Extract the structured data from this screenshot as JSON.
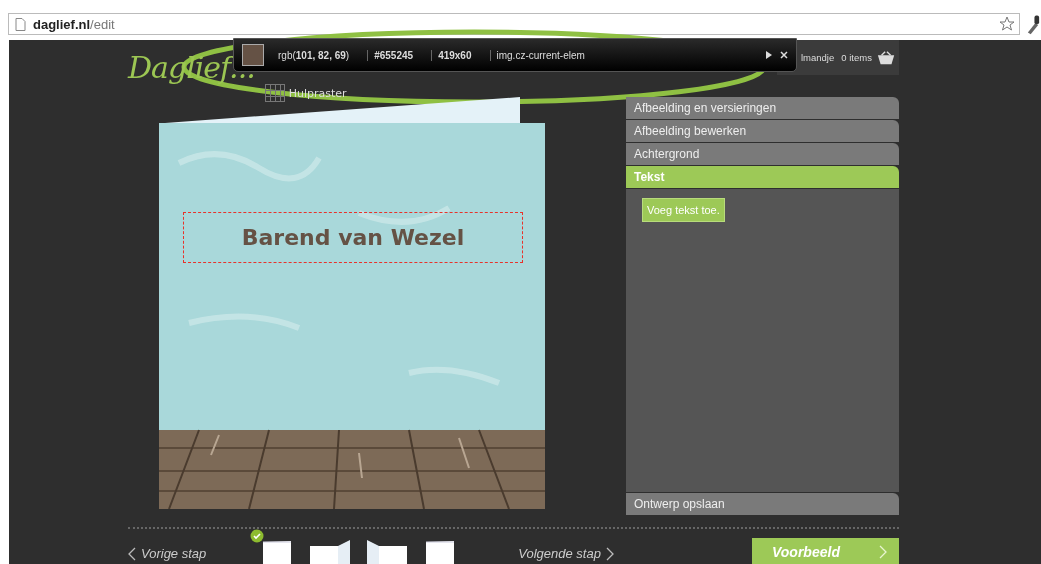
{
  "browser": {
    "url_domain": "daglief.nl",
    "url_path": "/edit"
  },
  "inspector": {
    "rgb": "rgb(**101, 82, 69**)",
    "hex": "#655245",
    "size": "419x60",
    "selector": "img.cz-current-elem"
  },
  "header": {
    "logo": "Daglief...",
    "grid_toggle": "Hulpraster",
    "cart_label": "lmandje",
    "cart_count": "0 items"
  },
  "card": {
    "name": "Barend van Wezel"
  },
  "panel": {
    "sections": [
      {
        "label": "Afbeelding en versieringen",
        "selected": false
      },
      {
        "label": "Afbeelding bewerken",
        "selected": false
      },
      {
        "label": "Achtergrond",
        "selected": false
      },
      {
        "label": "Tekst",
        "selected": true
      }
    ],
    "add_text_button": "Voeg tekst toe.",
    "save_section": "Ontwerp opslaan"
  },
  "footer": {
    "previous": "Vorige stap",
    "next": "Volgende stap",
    "preview": "Voorbeeld",
    "thumbnails": [
      {
        "kind": "single",
        "selected": true
      },
      {
        "kind": "fold-right",
        "selected": false
      },
      {
        "kind": "fold-left",
        "selected": false
      },
      {
        "kind": "single",
        "selected": false
      }
    ]
  }
}
